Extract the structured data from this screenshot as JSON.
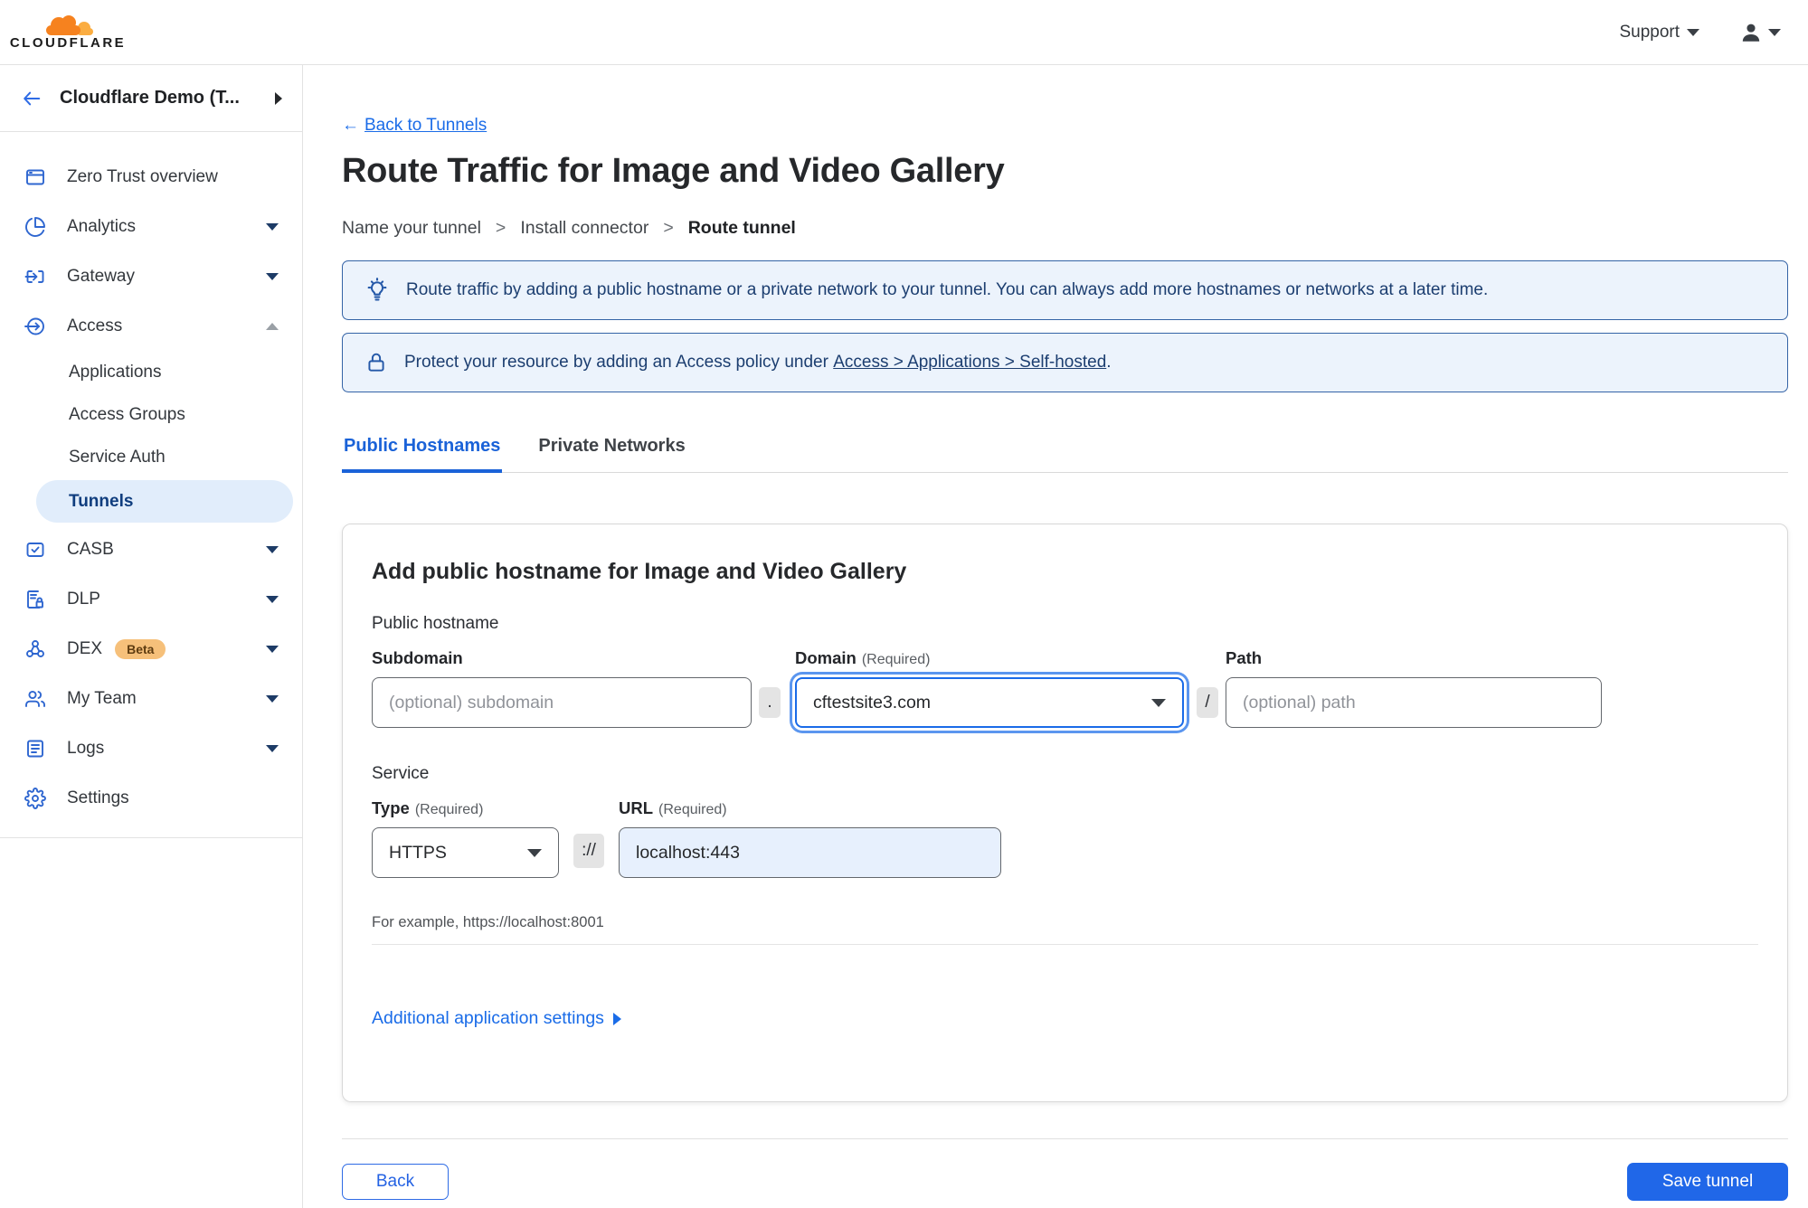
{
  "topbar": {
    "brand": "CLOUDFLARE",
    "support_label": "Support"
  },
  "sidebar": {
    "account": "Cloudflare Demo (T...",
    "items": [
      {
        "label": "Zero Trust overview",
        "icon": "window-icon",
        "expandable": false
      },
      {
        "label": "Analytics",
        "icon": "pie-chart-icon",
        "expandable": true
      },
      {
        "label": "Gateway",
        "icon": "gateway-icon",
        "expandable": true
      },
      {
        "label": "Access",
        "icon": "access-icon",
        "expandable": true,
        "expanded": true
      },
      {
        "label": "CASB",
        "icon": "casb-check-icon",
        "expandable": true
      },
      {
        "label": "DLP",
        "icon": "document-lock-icon",
        "expandable": true
      },
      {
        "label": "DEX",
        "icon": "network-nodes-icon",
        "expandable": true,
        "badge": "Beta"
      },
      {
        "label": "My Team",
        "icon": "people-icon",
        "expandable": true
      },
      {
        "label": "Logs",
        "icon": "list-document-icon",
        "expandable": true
      },
      {
        "label": "Settings",
        "icon": "gear-icon",
        "expandable": false
      }
    ],
    "access_children": [
      {
        "label": "Applications"
      },
      {
        "label": "Access Groups"
      },
      {
        "label": "Service Auth"
      },
      {
        "label": "Tunnels",
        "active": true
      }
    ],
    "dex_badge": "Beta"
  },
  "main": {
    "back_link": {
      "arrow": "←",
      "label": "Back to Tunnels"
    },
    "title": "Route Traffic for Image and Video Gallery",
    "steps": {
      "s1": "Name your tunnel",
      "sep": ">",
      "s2": "Install connector",
      "s3": "Route tunnel"
    },
    "banners": {
      "tip": "Route traffic by adding a public hostname or a private network to your tunnel. You can always add more hostnames or networks at a later time.",
      "protect_prefix": "Protect your resource by adding an Access policy under",
      "protect_link": "Access > Applications > Self-hosted",
      "protect_suffix": "."
    },
    "tabs": {
      "public": "Public Hostnames",
      "private": "Private Networks"
    },
    "card": {
      "heading": "Add public hostname for Image and Video Gallery",
      "public_hostname_label": "Public hostname",
      "subdomain_label": "Subdomain",
      "subdomain_placeholder": "(optional) subdomain",
      "dot": ".",
      "domain_label": "Domain",
      "required": "(Required)",
      "domain_value": "cftestsite3.com",
      "slash": "/",
      "path_label": "Path",
      "path_placeholder": "(optional) path",
      "service_label": "Service",
      "type_label": "Type",
      "type_value": "HTTPS",
      "scheme": "://",
      "url_label": "URL",
      "url_value": "localhost:443",
      "example": "For example, https://localhost:8001",
      "additional": "Additional application settings"
    },
    "footer": {
      "back": "Back",
      "save": "Save tunnel"
    }
  },
  "colors": {
    "brand_orange": "#F6821F",
    "brand_orange_light": "#FBAD41",
    "accent_blue": "#1A6CE8",
    "tab_active_blue": "#1A62D8",
    "banner_bg": "#ECF3FC",
    "banner_border": "#3463A6",
    "banner_text": "#1C3E70",
    "active_item_bg": "#E1EDFB",
    "save_button_bg": "#2067E8",
    "url_field_bg": "#E7F0FD",
    "beta_badge_bg": "#F6C07A"
  },
  "icons": {
    "list": [
      "cloudflare-logo",
      "window-icon",
      "pie-chart-icon",
      "gateway-icon",
      "access-icon",
      "casb-check-icon",
      "document-lock-icon",
      "network-nodes-icon",
      "people-icon",
      "list-document-icon",
      "gear-icon",
      "lightbulb-icon",
      "lock-icon",
      "chevron-down-icon",
      "chevron-up-icon",
      "chevron-right-icon",
      "back-arrow-icon",
      "user-icon"
    ]
  }
}
